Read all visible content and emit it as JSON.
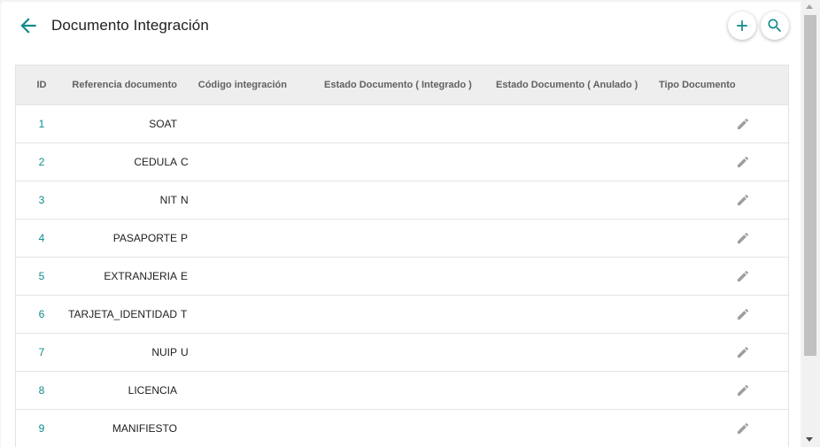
{
  "header": {
    "title": "Documento Integración",
    "back_icon": "arrow-left-icon",
    "add_icon": "plus-icon",
    "search_icon": "search-icon",
    "accent_color": "#0f8a8a"
  },
  "table": {
    "columns": {
      "id": "ID",
      "referencia": "Referencia documento",
      "codigo": "Código integración",
      "integrado": "Estado Documento ( Integrado )",
      "anulado": "Estado Documento ( Anulado )",
      "tipo": "Tipo Documento"
    },
    "rows": [
      {
        "id": "1",
        "referencia": "SOAT",
        "codigo": ""
      },
      {
        "id": "2",
        "referencia": "CEDULA",
        "codigo": "C"
      },
      {
        "id": "3",
        "referencia": "NIT",
        "codigo": "N"
      },
      {
        "id": "4",
        "referencia": "PASAPORTE",
        "codigo": "P"
      },
      {
        "id": "5",
        "referencia": "EXTRANJERIA",
        "codigo": "E"
      },
      {
        "id": "6",
        "referencia": "TARJETA_IDENTIDAD",
        "codigo": "T"
      },
      {
        "id": "7",
        "referencia": "NUIP",
        "codigo": "U"
      },
      {
        "id": "8",
        "referencia": "LICENCIA",
        "codigo": ""
      },
      {
        "id": "9",
        "referencia": "MANIFIESTO",
        "codigo": ""
      }
    ],
    "row_action_icon": "pencil-edit-icon"
  }
}
